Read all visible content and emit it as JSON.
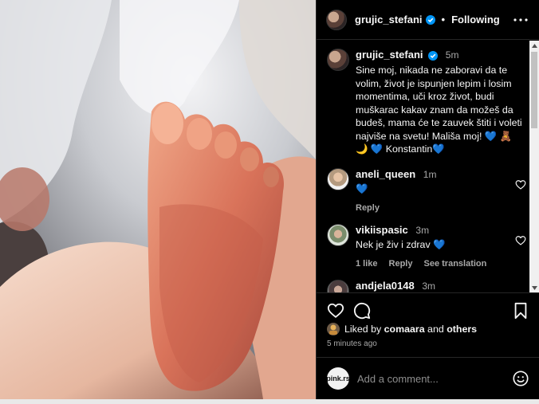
{
  "post": {
    "username": "grujic_stefani",
    "follow_state": "Following",
    "separator": "•",
    "time": "5m",
    "caption": "Sine moj, nikada ne zaboravi da te volim, život je ispunjen lepim i losim momentima, uči kroz život, budi muškarac kakav znam da možeš da budeš, mama će te zauvek štiti i voleti najviše na svetu! Mališa moj! 💙 🧸 🌙 💙 Konstantin💙"
  },
  "comments": [
    {
      "username": "aneli_queen",
      "time": "1m",
      "text": "💙",
      "actions": [
        "Reply"
      ]
    },
    {
      "username": "vikiispasic",
      "time": "3m",
      "text": "Nek je živ i zdrav 💙",
      "actions": [
        "1 like",
        "Reply",
        "See translation"
      ]
    },
    {
      "username": "andjela0148",
      "time": "3m",
      "text": "",
      "actions": []
    }
  ],
  "likes": {
    "prefix": "Liked by",
    "user": "comaara",
    "joiner": "and",
    "others": "others"
  },
  "time_ago": "5 minutes ago",
  "add_comment": {
    "avatar_text": "pink.rs",
    "placeholder": "Add a comment..."
  },
  "icons": {
    "verified": "verified-badge-icon",
    "more": "more-options-icon",
    "like": "heart-icon",
    "comment": "comment-bubble-icon",
    "save": "bookmark-icon",
    "emoji": "emoji-icon"
  },
  "colors": {
    "background": "#000000",
    "text": "#f5f5f5",
    "muted": "#a8a8a8",
    "verified": "#0095f6",
    "border": "#262626"
  }
}
